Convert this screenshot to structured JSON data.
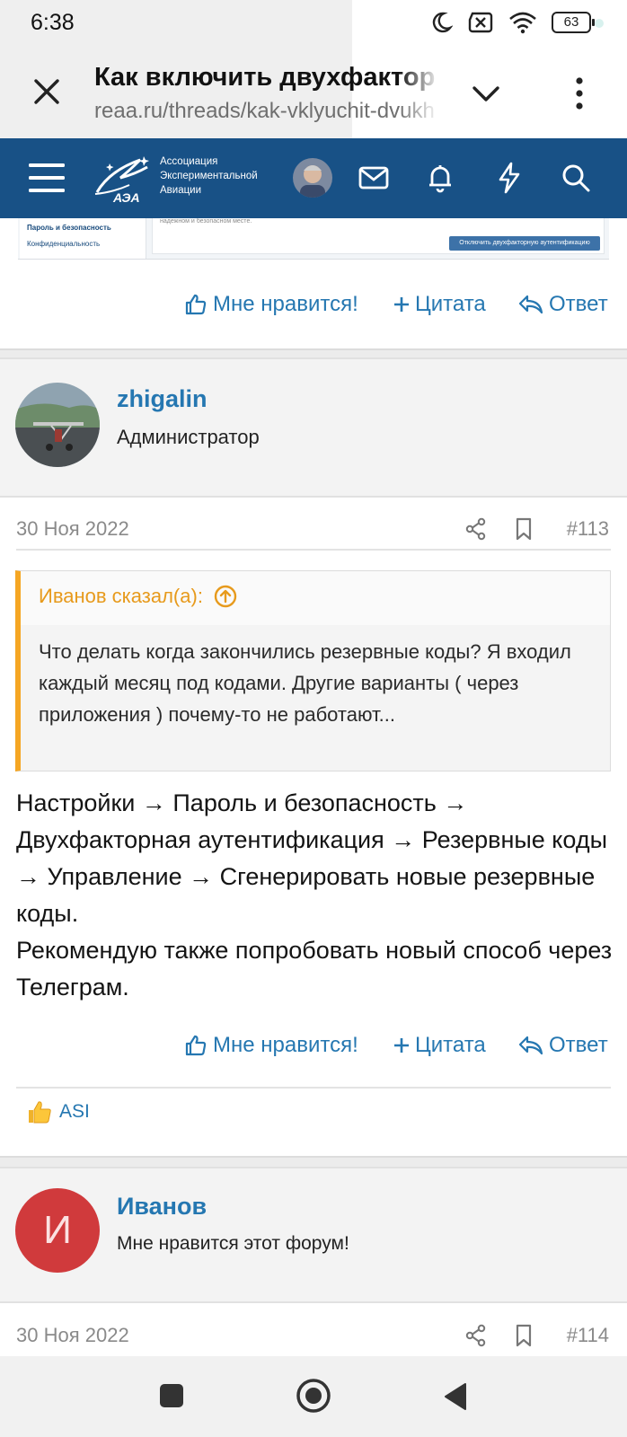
{
  "status": {
    "time": "6:38",
    "battery": "63"
  },
  "browser": {
    "title": "Как включить двухфактор",
    "url": "reaa.ru/threads/kak-vklyuchit-dvukh"
  },
  "site": {
    "org_line1": "Ассоциация",
    "org_line2": "Экспериментальной",
    "org_line3": "Авиации",
    "logo_mark": "АЭА"
  },
  "screenshot": {
    "sidebar_item1": "Пароль и безопасность",
    "sidebar_item2": "Конфиденциальность",
    "main_text": "надежном и безопасном месте.",
    "button": "Отключить двухфакторную аутентификацию"
  },
  "actions": {
    "like": "Мне нравится!",
    "quote": "Цитата",
    "reply": "Ответ"
  },
  "post113": {
    "author": "zhigalin",
    "role": "Администратор",
    "date": "30 Ноя 2022",
    "number": "#113",
    "quote_author": "Иванов сказал(а):",
    "quote_text": "Что делать когда закончились резервные коды? Я входил каждый месяц под кодами. Другие варианты ( через приложения ) почему-то не работают...",
    "body_line1": "Настройки → Пароль и безопасность → Двухфакторная аутентификация → Резервные коды → Управление → Сгенерировать новые резервные коды.",
    "body_line2": "Рекомендую также попробовать новый способ через Телеграм.",
    "reaction_user": "ASI"
  },
  "post114": {
    "author": "Иванов",
    "avatar_letter": "И",
    "role": "Мне нравится этот форум!",
    "date": "30 Ноя 2022",
    "number": "#114"
  },
  "colors": {
    "header": "#185186",
    "link": "#2577b1",
    "quote_accent": "#f5a623",
    "avatar_red": "#d03a3c"
  }
}
